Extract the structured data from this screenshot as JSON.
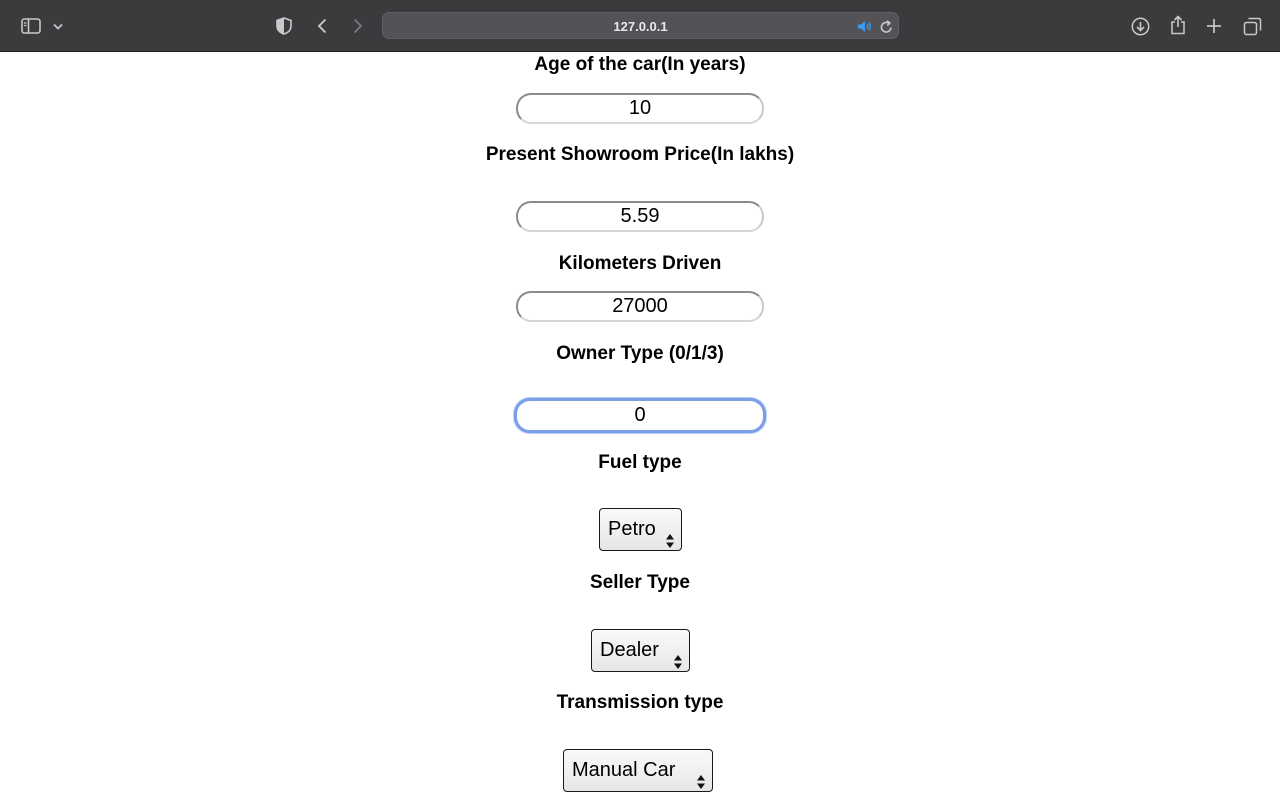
{
  "browser": {
    "url": "127.0.0.1",
    "icons": {
      "sidebar": "sidebar-icon",
      "tab_overview_chevron": "chevron-down-icon",
      "privacy": "shield-icon",
      "back": "back-arrow-icon",
      "forward": "forward-arrow-icon",
      "audio": "speaker-icon",
      "reload": "reload-icon",
      "downloads": "download-icon",
      "share": "share-icon",
      "new_tab": "plus-icon",
      "tabs": "tabs-icon"
    }
  },
  "form": {
    "age": {
      "label": "Age of the car(In years)",
      "value": "10"
    },
    "price": {
      "label": "Present Showroom Price(In lakhs)",
      "value": "5.59"
    },
    "kms": {
      "label": "Kilometers Driven",
      "value": "27000"
    },
    "owner": {
      "label": "Owner Type (0/1/3)",
      "value": "0"
    },
    "fuel": {
      "label": "Fuel type",
      "selected": "Petro"
    },
    "seller": {
      "label": "Seller Type",
      "selected": "Dealer"
    },
    "transmission": {
      "label": "Transmission type",
      "selected": "Manual Car"
    }
  },
  "colors": {
    "toolbar_bg": "#3b3a3d",
    "focus_ring": "#7c9ee6",
    "audio_accent": "#3a9bf0"
  }
}
